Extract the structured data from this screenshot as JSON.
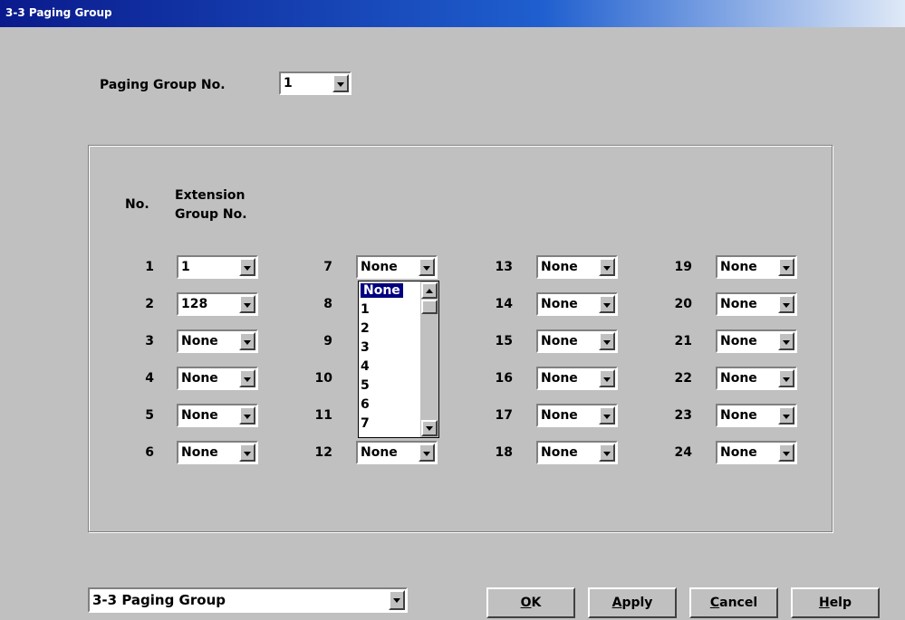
{
  "window": {
    "title": "3-3 Paging Group"
  },
  "paging_group": {
    "label": "Paging Group No.",
    "value": "1"
  },
  "table": {
    "header_no": "No.",
    "header_ext_line1": "Extension",
    "header_ext_line2": "Group No.",
    "columns": [
      [
        {
          "no": "1",
          "value": "1"
        },
        {
          "no": "2",
          "value": "128"
        },
        {
          "no": "3",
          "value": "None"
        },
        {
          "no": "4",
          "value": "None"
        },
        {
          "no": "5",
          "value": "None"
        },
        {
          "no": "6",
          "value": "None"
        }
      ],
      [
        {
          "no": "7",
          "value": "None"
        },
        {
          "no": "8",
          "value": ""
        },
        {
          "no": "9",
          "value": ""
        },
        {
          "no": "10",
          "value": ""
        },
        {
          "no": "11",
          "value": ""
        },
        {
          "no": "12",
          "value": "None"
        }
      ],
      [
        {
          "no": "13",
          "value": "None"
        },
        {
          "no": "14",
          "value": "None"
        },
        {
          "no": "15",
          "value": "None"
        },
        {
          "no": "16",
          "value": "None"
        },
        {
          "no": "17",
          "value": "None"
        },
        {
          "no": "18",
          "value": "None"
        }
      ],
      [
        {
          "no": "19",
          "value": "None"
        },
        {
          "no": "20",
          "value": "None"
        },
        {
          "no": "21",
          "value": "None"
        },
        {
          "no": "22",
          "value": "None"
        },
        {
          "no": "23",
          "value": "None"
        },
        {
          "no": "24",
          "value": "None"
        }
      ]
    ]
  },
  "dropdown_list": {
    "items": [
      "None",
      "1",
      "2",
      "3",
      "4",
      "5",
      "6",
      "7"
    ],
    "selected": "None"
  },
  "footer": {
    "page_selector": "3-3 Paging Group",
    "ok_label": "OK",
    "apply_label": "Apply",
    "cancel_label": "Cancel",
    "help_label": "Help"
  }
}
